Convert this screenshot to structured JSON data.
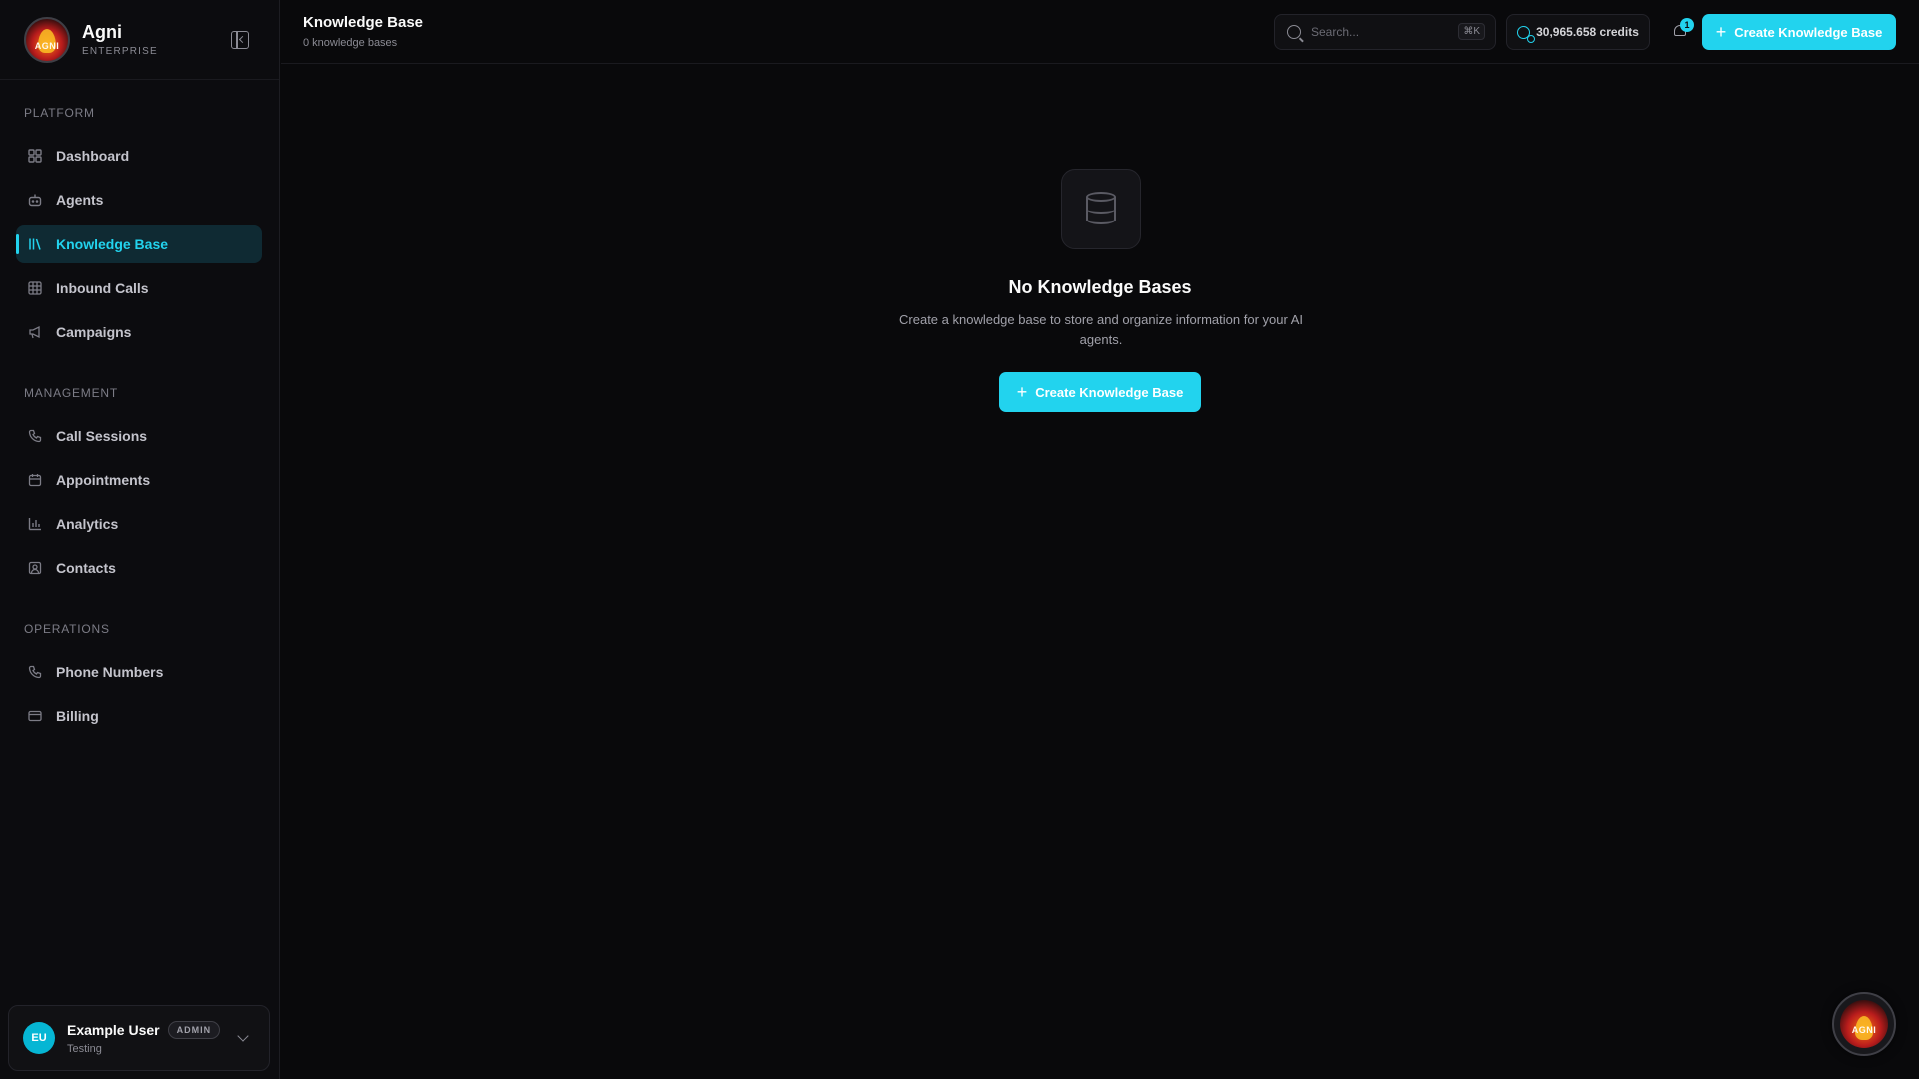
{
  "brand": {
    "name": "Agni",
    "tier": "ENTERPRISE",
    "logo_text": "AGNI"
  },
  "sidebar": {
    "sections": [
      {
        "title": "PLATFORM",
        "items": [
          {
            "label": "Dashboard",
            "icon": "grid-icon"
          },
          {
            "label": "Agents",
            "icon": "bot-icon"
          },
          {
            "label": "Knowledge Base",
            "icon": "library-icon",
            "active": true
          },
          {
            "label": "Inbound Calls",
            "icon": "table-icon"
          },
          {
            "label": "Campaigns",
            "icon": "megaphone-icon"
          }
        ]
      },
      {
        "title": "MANAGEMENT",
        "items": [
          {
            "label": "Call Sessions",
            "icon": "phone-icon"
          },
          {
            "label": "Appointments",
            "icon": "calendar-icon"
          },
          {
            "label": "Analytics",
            "icon": "bar-chart-icon"
          },
          {
            "label": "Contacts",
            "icon": "contact-icon"
          }
        ]
      },
      {
        "title": "OPERATIONS",
        "items": [
          {
            "label": "Phone Numbers",
            "icon": "phone-icon"
          },
          {
            "label": "Billing",
            "icon": "credit-card-icon"
          }
        ]
      }
    ],
    "user": {
      "initials": "EU",
      "name": "Example User",
      "role": "ADMIN",
      "org": "Testing"
    }
  },
  "header": {
    "title": "Knowledge Base",
    "subtitle": "0 knowledge bases",
    "search_placeholder": "Search...",
    "search_shortcut": "⌘K",
    "credits": "30,965.658 credits",
    "notifications": "1",
    "create_label": "Create Knowledge Base"
  },
  "empty_state": {
    "title": "No Knowledge Bases",
    "description": "Create a knowledge base to store and organize information for your AI agents.",
    "create_label": "Create Knowledge Base"
  },
  "colors": {
    "accent": "#22d3ee",
    "background": "#09090b",
    "sidebar": "#0c0c0f",
    "active_bg": "#0f2a33"
  }
}
